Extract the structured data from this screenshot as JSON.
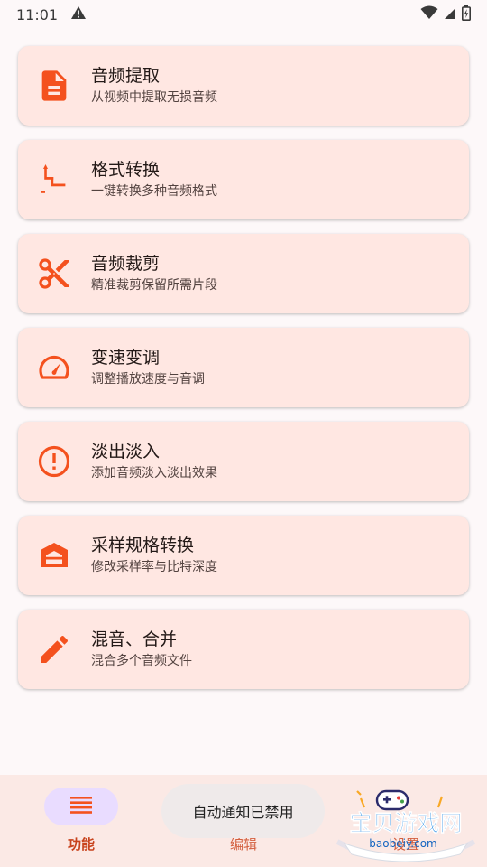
{
  "status_bar": {
    "time": "11:01",
    "icons": [
      "alert-triangle-icon",
      "wifi-icon",
      "signal-icon",
      "battery-icon"
    ]
  },
  "colors": {
    "accent": "#f4511e",
    "card_bg": "#ffe7e2",
    "nav_bg": "#fbe9e5",
    "selected_pill": "#e9dcff"
  },
  "features": [
    {
      "id": "extract",
      "icon": "document-icon",
      "title": "音频提取",
      "subtitle": "从视频中提取无损音频"
    },
    {
      "id": "format",
      "icon": "format-convert-icon",
      "title": "格式转换",
      "subtitle": "一键转换多种音频格式"
    },
    {
      "id": "cut",
      "icon": "scissors-icon",
      "title": "音频裁剪",
      "subtitle": "精准裁剪保留所需片段"
    },
    {
      "id": "speed",
      "icon": "speedometer-icon",
      "title": "变速变调",
      "subtitle": "调整播放速度与音调"
    },
    {
      "id": "fade",
      "icon": "alert-circle-icon",
      "title": "淡出淡入",
      "subtitle": "添加音频淡入淡出效果"
    },
    {
      "id": "sample",
      "icon": "house-icon",
      "title": "采样规格转换",
      "subtitle": "修改采样率与比特深度"
    },
    {
      "id": "mix",
      "icon": "pencil-icon",
      "title": "混音、合并",
      "subtitle": "混合多个音频文件"
    }
  ],
  "bottom_nav": {
    "items": [
      {
        "label": "功能",
        "icon": "menu-lines-icon",
        "selected": true
      },
      {
        "label": "编辑",
        "selected": false
      },
      {
        "label": "设置",
        "selected": false
      }
    ]
  },
  "toast": {
    "text": "自动通知已禁用"
  },
  "watermark": {
    "title": "宝贝游戏网",
    "url": "baobeiy.com"
  }
}
